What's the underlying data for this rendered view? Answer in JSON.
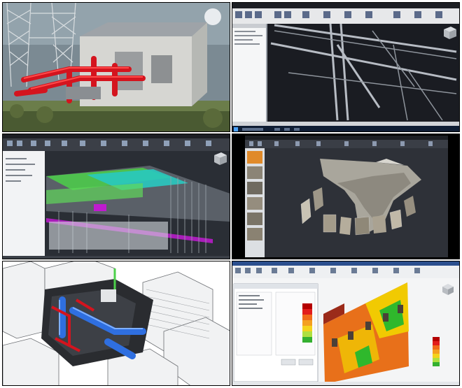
{
  "grid": {
    "panels": [
      {
        "id": "photo-pipe-skid",
        "kind": "photo"
      },
      {
        "id": "revit-steel-structure",
        "kind": "software-screenshot"
      },
      {
        "id": "cad-pointcloud-floor",
        "kind": "software-screenshot"
      },
      {
        "id": "photogrammetry-bridge",
        "kind": "software-screenshot"
      },
      {
        "id": "bim-duct-isometric",
        "kind": "render"
      },
      {
        "id": "surface-deviation-heatmap",
        "kind": "software-screenshot"
      }
    ]
  },
  "colors": {
    "pipe_red": "#d4141e",
    "dark_ui": "#2b2d33",
    "ribbon": "#3b3f47",
    "pointcloud_green": "#4cd04a",
    "cyan_plane": "#29c9c0",
    "magenta_band": "#c01ad0",
    "duct_blue": "#2f6fe0",
    "heat_orange": "#e8701a",
    "heat_yellow": "#f2d400",
    "heat_green": "#2fb82c"
  },
  "icons": [
    "view-cube-icon",
    "search-icon",
    "ribbon-tool-icon",
    "windows-start-icon"
  ],
  "heatmap_legend": {
    "levels": [
      1.0,
      0.85,
      0.7,
      0.55,
      0.4,
      0.25,
      0.1
    ],
    "colors": [
      "#b40000",
      "#e21c1c",
      "#f06a1a",
      "#f4a020",
      "#f4d31c",
      "#aee040",
      "#34b030"
    ]
  }
}
